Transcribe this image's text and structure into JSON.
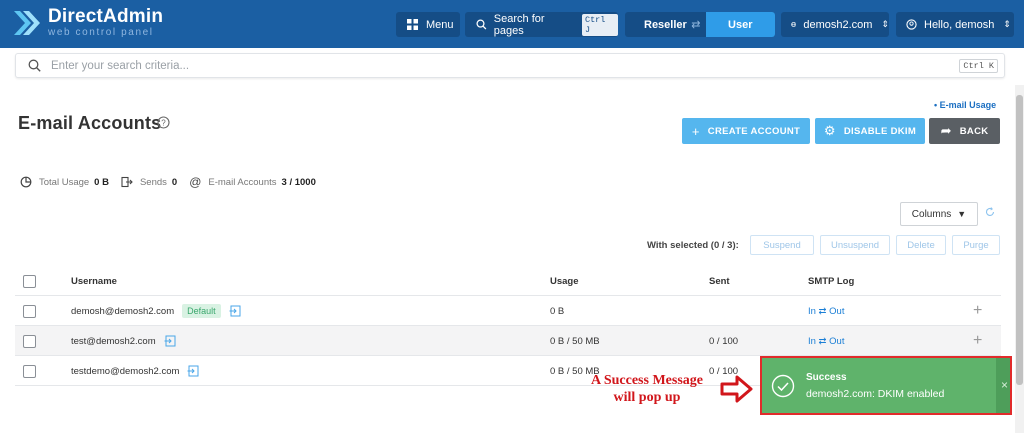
{
  "brand": {
    "title": "DirectAdmin",
    "subtitle": "web control panel"
  },
  "nav": {
    "menu_label": "Menu",
    "search_label": "Search for pages",
    "search_shortcut": "Ctrl J",
    "role_reseller": "Reseller",
    "role_user": "User",
    "domain_label": "demosh2.com",
    "greeting": "Hello, demosh"
  },
  "search": {
    "placeholder": "Enter your search criteria...",
    "shortcut": "Ctrl K"
  },
  "page": {
    "title": "E-mail Accounts",
    "usage_link": "• E-mail Usage",
    "create_label": "CREATE ACCOUNT",
    "dkim_label": "DISABLE DKIM",
    "back_label": "BACK"
  },
  "stats": {
    "total_usage_label": "Total Usage",
    "total_usage_value": "0 B",
    "sends_label": "Sends",
    "sends_value": "0",
    "accounts_label": "E-mail Accounts",
    "accounts_value": "3 / 1000"
  },
  "toolbar": {
    "columns_label": "Columns",
    "with_selected": "With selected (0 / 3):",
    "suspend": "Suspend",
    "unsuspend": "Unsuspend",
    "delete": "Delete",
    "purge": "Purge"
  },
  "table": {
    "headers": {
      "username": "Username",
      "usage": "Usage",
      "sent": "Sent",
      "smtp": "SMTP Log"
    },
    "rows": [
      {
        "username": "demosh@demosh2.com",
        "badge": "Default",
        "usage": "0 B",
        "sent": "",
        "smtp": "In ⇄ Out"
      },
      {
        "username": "test@demosh2.com",
        "badge": "",
        "usage": "0 B / 50 MB",
        "sent": "0 / 100",
        "smtp": "In ⇄ Out"
      },
      {
        "username": "testdemo@demosh2.com",
        "badge": "",
        "usage": "0 B / 50 MB",
        "sent": "0 / 100",
        "smtp": ""
      }
    ]
  },
  "toast": {
    "title": "Success",
    "message": "demosh2.com: DKIM enabled",
    "close": "×"
  },
  "annotation": {
    "line1": "A Success Message",
    "line2": "will pop up"
  },
  "colors": {
    "header": "#1b5fa3",
    "primary_button": "#55b6ee",
    "back_button": "#5a5f64",
    "toast": "#5fb36b",
    "annotation": "#d1161b"
  }
}
